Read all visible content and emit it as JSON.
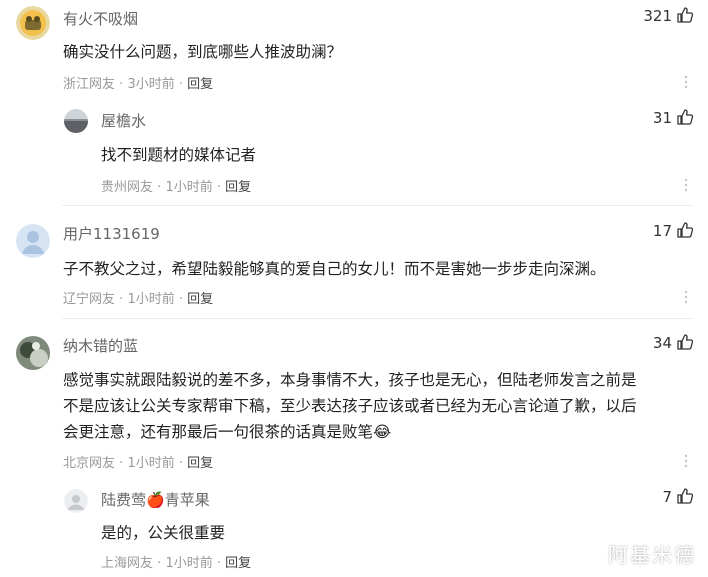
{
  "comments": [
    {
      "username": "有火不吸烟",
      "likes": "321",
      "text": "确实没什么问题，到底哪些人推波助澜？",
      "location": "浙江网友",
      "time": "3小时前",
      "reply_label": "回复"
    },
    {
      "username": "屋檐水",
      "likes": "31",
      "text": "找不到题材的媒体记者",
      "location": "贵州网友",
      "time": "1小时前",
      "reply_label": "回复"
    },
    {
      "username": "用户1131619",
      "likes": "17",
      "text": "子不教父之过，希望陆毅能够真的爱自己的女儿！而不是害她一步步走向深渊。",
      "location": "辽宁网友",
      "time": "1小时前",
      "reply_label": "回复"
    },
    {
      "username": "纳木错的蓝",
      "likes": "34",
      "text_lines": [
        "感觉事实就跟陆毅说的差不多，本身事情不大，孩子也是无心，但陆老师发言之前是",
        "不是应该让公关专家帮审下稿，至少表达孩子应该或者已经为无心言论道了歉，以后",
        "会更注意，还有那最后一句很茶的话真是败笔"
      ],
      "emoji": "😂",
      "location": "北京网友",
      "time": "1小时前",
      "reply_label": "回复"
    },
    {
      "username_part1": "陆费莺",
      "username_emoji": "🍎",
      "username_part2": "青苹果",
      "likes": "7",
      "text": "是的，公关很重要",
      "location": "上海网友",
      "time": "1小时前",
      "reply_label": "回复"
    }
  ],
  "meta_separator": "·",
  "watermark": "阿基米德"
}
